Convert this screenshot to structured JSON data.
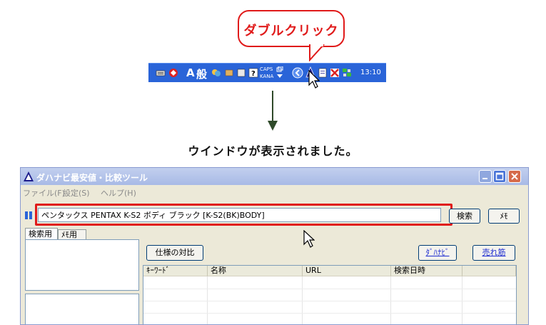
{
  "callout": {
    "text": "ダブルクリック"
  },
  "tray": {
    "a_label": "A",
    "ime_label": "般",
    "caps_label": "CAPS",
    "kana_label": "KANA",
    "clock": "13:10"
  },
  "caption": "ウインドウが表示されました。",
  "window": {
    "title": "ダハナビ最安値・比較ツール",
    "menu": [
      "ファイル(F)",
      "設定(S)",
      "ヘルプ(H)"
    ],
    "search_value": "ペンタックス PENTAX K-S2 ボディ ブラック [K-S2(BK)BODY]",
    "search_button": "検索",
    "memo_button": "ﾒﾓ",
    "tabs": [
      "検索用",
      "ﾒﾓ用"
    ],
    "spec_button": "仕様の対比",
    "dahanavi_link": "ﾀﾞﾊﾅﾋﾞ",
    "ranking_link": "売れ筋",
    "columns": [
      "ｷｰﾜｰﾄﾞ",
      "名称",
      "URL",
      "検索日時"
    ]
  },
  "colors": {
    "highlight": "#e01a1a",
    "taskbar": "#2a64d8",
    "arrow": "#2f4a2a"
  }
}
